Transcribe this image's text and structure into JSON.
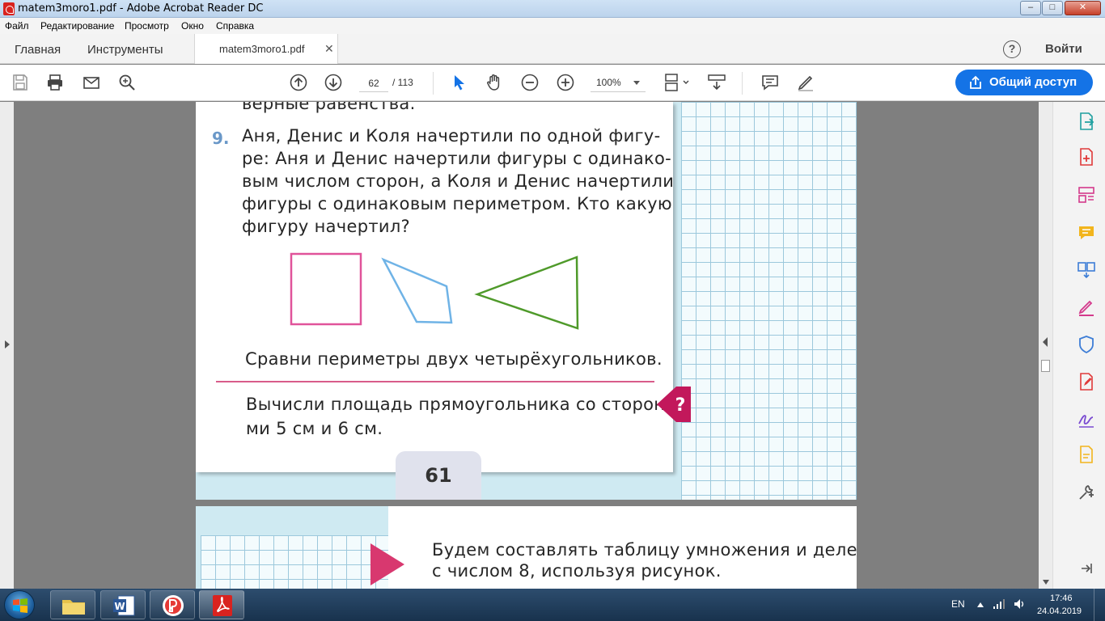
{
  "window": {
    "title": "matem3moro1.pdf - Adobe Acrobat Reader DC",
    "minimize": "–",
    "maximize": "□",
    "close": "✕"
  },
  "menu": [
    "Файл",
    "Редактирование",
    "Просмотр",
    "Окно",
    "Справка"
  ],
  "tabs": {
    "home": "Главная",
    "tools": "Инструменты",
    "document": "matem3moro1.pdf",
    "close": "✕",
    "help": "?",
    "sign_in": "Войти"
  },
  "toolbar": {
    "page_current": "62",
    "page_total": "/ 113",
    "zoom": "100%",
    "share_label": "Общий доступ"
  },
  "page": {
    "top_fragment": "верные равенства.",
    "task_number": "9.",
    "task_lines": [
      "Аня, Денис и Коля начертили по одной фигу-",
      "ре: Аня и Денис начертили фигуры с одинако-",
      "вым числом сторон, а Коля и Денис начертили",
      "фигуры с одинаковым периметром. Кто какую",
      "фигуру начертил?"
    ],
    "compare_text": "Сравни периметры двух четырёхугольников.",
    "area_lines": [
      "Вычисли площадь прямоугольника со сторона-",
      "ми 5 см и 6 см."
    ],
    "question_mark": "?",
    "page_number": "61",
    "next_lines": [
      "Будем составлять таблицу умножения и деления",
      "с числом 8, используя рисунок."
    ],
    "colors": {
      "square": "#e0539a",
      "quad": "#6fb3e6",
      "triangle": "#4f9a2a",
      "accent": "#c2185b"
    }
  },
  "taskbar": {
    "lang": "EN",
    "time": "17:46",
    "date": "24.04.2019",
    "apps": [
      "explorer-icon",
      "word-icon",
      "yandex-browser-icon",
      "acrobat-icon"
    ]
  }
}
